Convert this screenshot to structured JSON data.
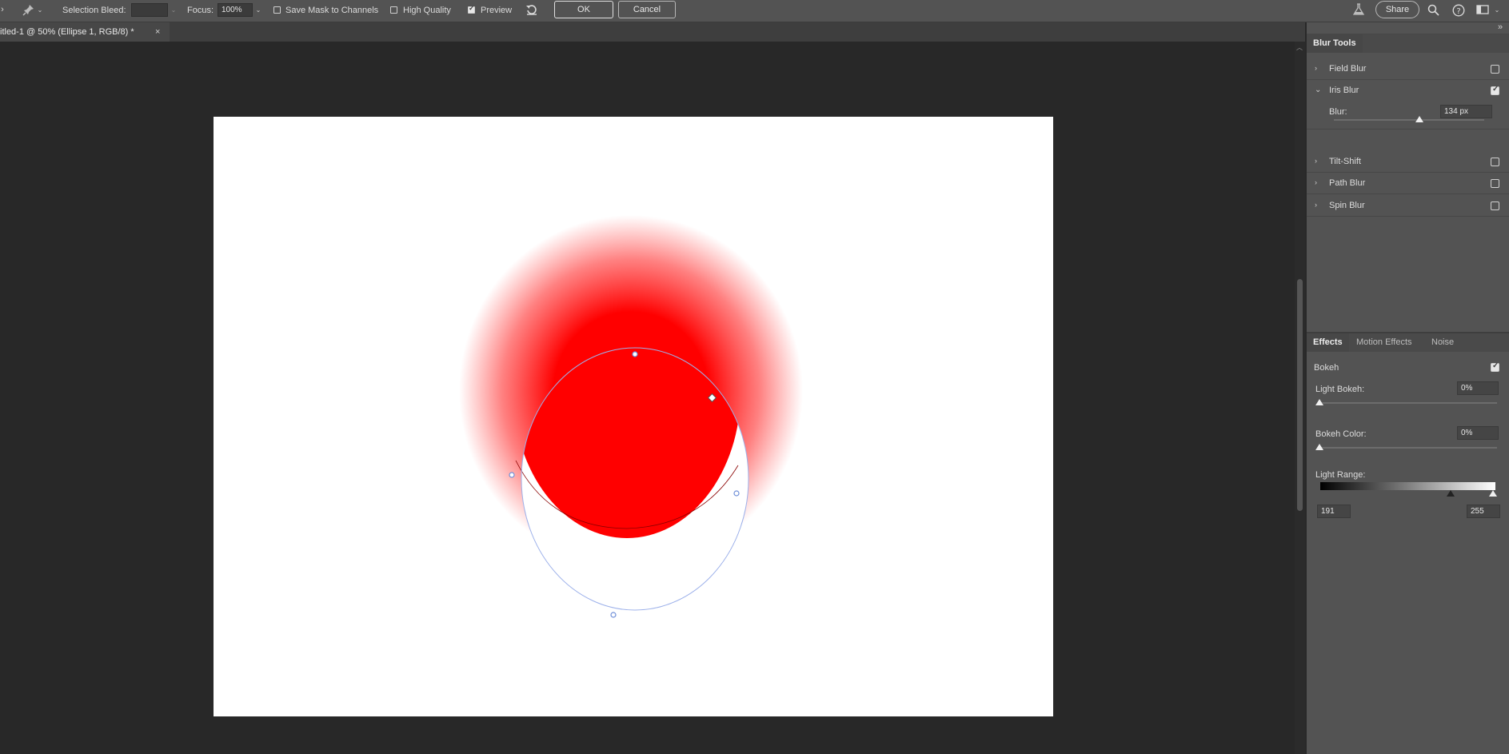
{
  "optionsbar": {
    "selection_bleed_label": "Selection Bleed:",
    "selection_bleed_value": "",
    "focus_label": "Focus:",
    "focus_value": "100%",
    "save_mask_label": "Save Mask to Channels",
    "save_mask_checked": false,
    "high_quality_label": "High Quality",
    "high_quality_checked": false,
    "preview_label": "Preview",
    "preview_checked": true,
    "ok_label": "OK",
    "cancel_label": "Cancel",
    "share_label": "Share",
    "icons": [
      "pin-tool-icon",
      "reset-icon",
      "flask-icon",
      "search-icon",
      "help-icon",
      "workspace-icon"
    ]
  },
  "document": {
    "tab_title": "itled-1 @ 50% (Ellipse 1, RGB/8) *",
    "close_glyph": "×"
  },
  "blur_tools": {
    "title": "Blur Tools",
    "items": [
      {
        "label": "Field Blur",
        "expanded": false,
        "checked": false
      },
      {
        "label": "Iris Blur",
        "expanded": true,
        "checked": true
      },
      {
        "label": "Tilt-Shift",
        "expanded": false,
        "checked": false
      },
      {
        "label": "Path Blur",
        "expanded": false,
        "checked": false
      },
      {
        "label": "Spin Blur",
        "expanded": false,
        "checked": false
      }
    ],
    "blur_label": "Blur:",
    "blur_value": "134 px",
    "blur_slider_fraction": 0.57
  },
  "effects": {
    "tabs": [
      "Effects",
      "Motion Effects",
      "Noise"
    ],
    "active_tab": "Effects",
    "bokeh_label": "Bokeh",
    "bokeh_checked": true,
    "light_bokeh_label": "Light Bokeh:",
    "light_bokeh_value": "0%",
    "bokeh_color_label": "Bokeh Color:",
    "bokeh_color_value": "0%",
    "light_range_label": "Light Range:",
    "light_range_low": "191",
    "light_range_high": "255"
  },
  "colors": {
    "ui_bg": "#535353",
    "canvas_bg": "#282828",
    "shape_fill": "#ff0000",
    "path_outline": "#8fa8e6"
  }
}
